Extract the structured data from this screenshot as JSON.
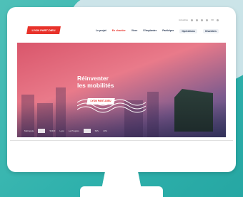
{
  "site": {
    "logo_text": "LYON PART-DIEU",
    "utility": {
      "lang": "Actualités",
      "lang2": "FR"
    },
    "menu": [
      {
        "label": "Le projet",
        "active": false
      },
      {
        "label": "En chantier",
        "active": true
      },
      {
        "label": "Vivre",
        "active": false
      },
      {
        "label": "S'implanter",
        "active": false
      },
      {
        "label": "Participer",
        "active": false
      },
      {
        "label": "Opérations",
        "active": false
      },
      {
        "label": "Chantiers",
        "active": false
      }
    ],
    "hero": {
      "title_line1": "Réinventer",
      "title_line2": "les mobilités",
      "tag": "LYON PART-DIEU"
    },
    "partners": [
      "Métropole",
      "SNCF",
      "Lyon",
      "Le Progrès",
      "SPL",
      "LPA"
    ]
  },
  "colors": {
    "brand_red": "#e8322a",
    "teal_bg": "#2fb1ac",
    "monitor": "#ffffff"
  }
}
